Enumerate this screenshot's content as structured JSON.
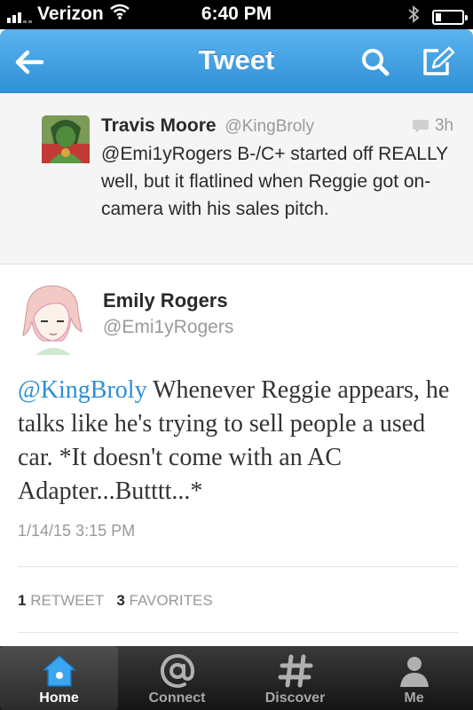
{
  "status_bar": {
    "carrier": "Verizon",
    "time": "6:40 PM"
  },
  "nav": {
    "title": "Tweet"
  },
  "reply_tweet": {
    "name": "Travis Moore",
    "handle": "@KingBroly",
    "time": "3h",
    "text": "@Emi1yRogers B-/C+ started off REALLY well, but it flatlined when Reggie got on-camera with his sales pitch."
  },
  "main_tweet": {
    "name": "Emily Rogers",
    "handle": "@Emi1yRogers",
    "mention": "@KingBroly",
    "text": " Whenever Reggie appears, he talks like he's trying to sell people a used car. *It doesn't come with an AC Adapter...Butttt...*",
    "date": "1/14/15 3:15 PM",
    "retweet_count": "1",
    "retweet_label": "RETWEET",
    "favorite_count": "3",
    "favorite_label": "FAVORITES"
  },
  "tabs": [
    {
      "label": "Home",
      "icon": "home-icon"
    },
    {
      "label": "Connect",
      "icon": "at-icon"
    },
    {
      "label": "Discover",
      "icon": "hash-icon"
    },
    {
      "label": "Me",
      "icon": "person-icon"
    }
  ],
  "colors": {
    "accent": "#2c8ed6",
    "nav_bar": "#3d9de0",
    "tab_active": "#ffffff"
  }
}
